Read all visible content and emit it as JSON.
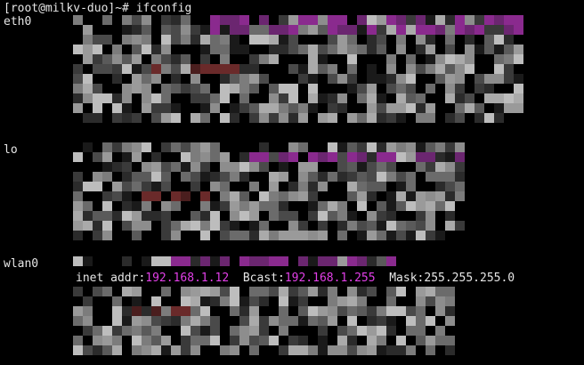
{
  "terminal": {
    "prompt": "[root@milkv-duo]~# ifconfig",
    "interfaces": [
      {
        "name": "eth0"
      },
      {
        "name": "lo"
      },
      {
        "name": "wlan0"
      }
    ],
    "wlan0": {
      "inet_prefix": "inet addr:",
      "inet_addr": "192.168.1.12",
      "bcast_prefix": "  Bcast:",
      "bcast_addr": "192.168.1.255",
      "mask_prefix": "  Mask:",
      "mask": "255.255.255.0"
    }
  },
  "colors": {
    "background": "#000000",
    "text": "#e6e6e6",
    "highlight": "#e23fe8"
  }
}
